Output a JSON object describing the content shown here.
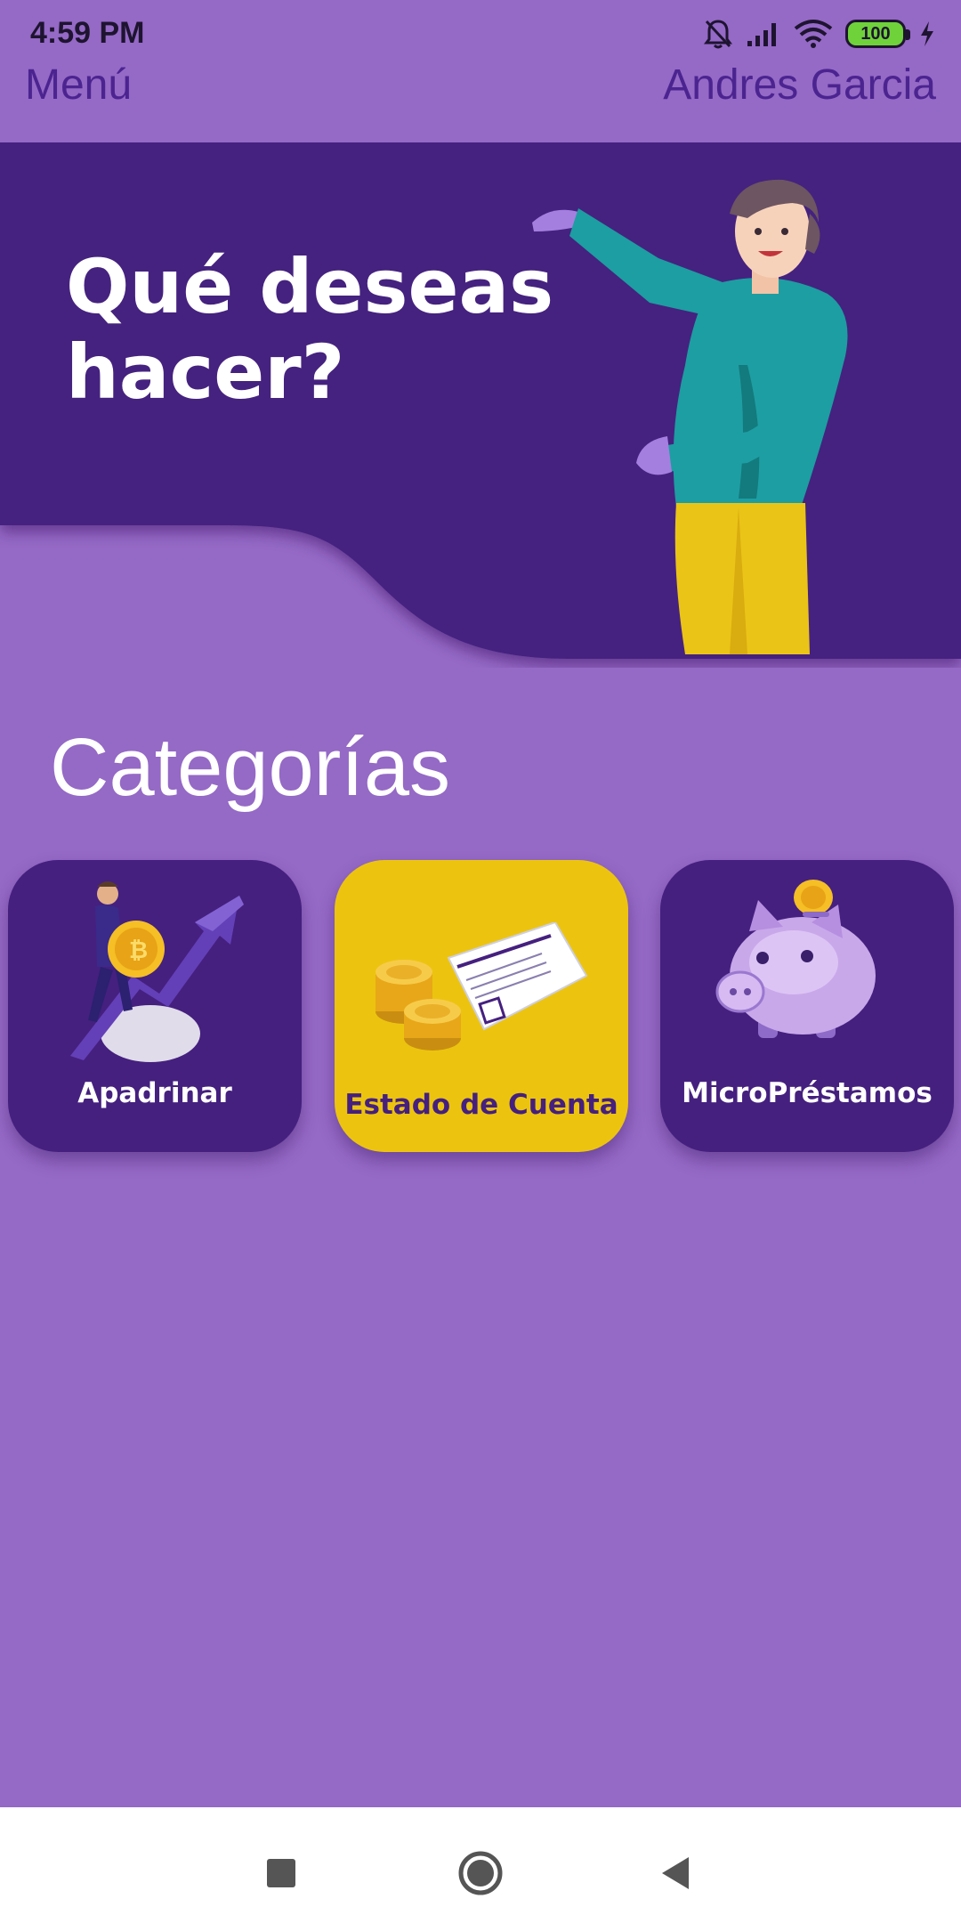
{
  "status_bar": {
    "time": "4:59 PM",
    "battery": "100",
    "icons": [
      "bell-off-icon",
      "signal-icon",
      "wifi-icon",
      "battery-icon",
      "charging-icon"
    ]
  },
  "header": {
    "menu_label": "Menú",
    "user_name": "Andres Garcia"
  },
  "hero": {
    "title": "Qué deseas hacer?"
  },
  "categories": {
    "title": "Categorías",
    "items": [
      {
        "label": "Apadrinar",
        "icon": "investor-growth-icon"
      },
      {
        "label": "Estado de Cuenta",
        "icon": "coins-receipt-icon"
      },
      {
        "label": "MicroPréstamos",
        "icon": "piggy-bank-icon"
      }
    ]
  },
  "navigation": {
    "buttons": [
      "recent-apps",
      "home",
      "back"
    ]
  },
  "colors": {
    "background": "#9569c6",
    "banner": "#45207f",
    "accent_yellow": "#ecc40f",
    "header_text": "#4b2490"
  }
}
